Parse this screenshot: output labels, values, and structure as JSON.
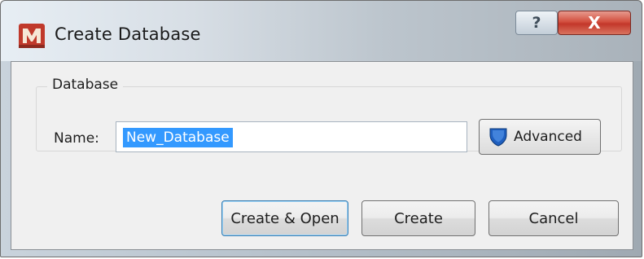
{
  "window": {
    "title": "Create Database",
    "help_label": "?",
    "close_label": "X"
  },
  "group": {
    "title": "Database"
  },
  "name_field": {
    "label": "Name:",
    "value": "New_Database"
  },
  "buttons": {
    "advanced": "Advanced",
    "create_open": "Create & Open",
    "create": "Create",
    "cancel": "Cancel"
  },
  "icons": {
    "app": "app-logo-icon",
    "advanced": "shield-icon"
  },
  "colors": {
    "selection": "#3399ff",
    "close_button": "#c3372a",
    "shield": "#1f5fbf"
  }
}
